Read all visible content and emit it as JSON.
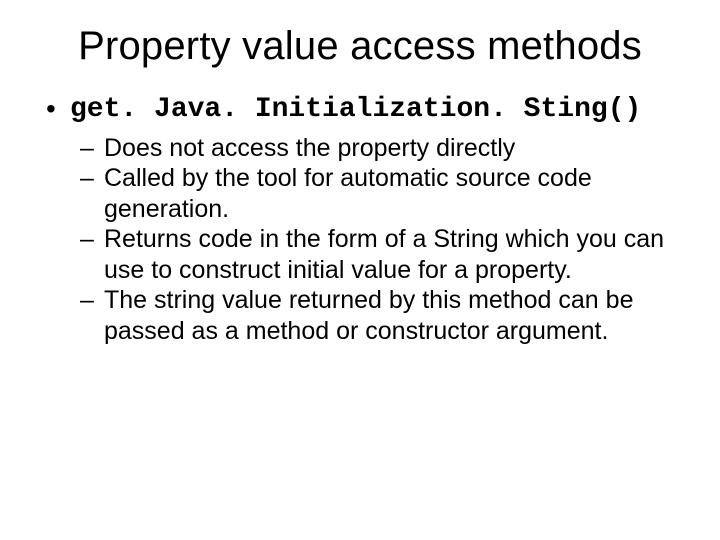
{
  "title": "Property value access methods",
  "bullet1_char": "•",
  "bullet2_char": "–",
  "item1": {
    "label": "get. Java. Initialization. Sting()",
    "subitems": [
      "Does not access the property directly",
      "Called by the tool for automatic source code generation.",
      "Returns code in the form of a String which you can use to construct initial value for a property.",
      "The string value returned by this method can be passed as a method or constructor argument."
    ]
  }
}
